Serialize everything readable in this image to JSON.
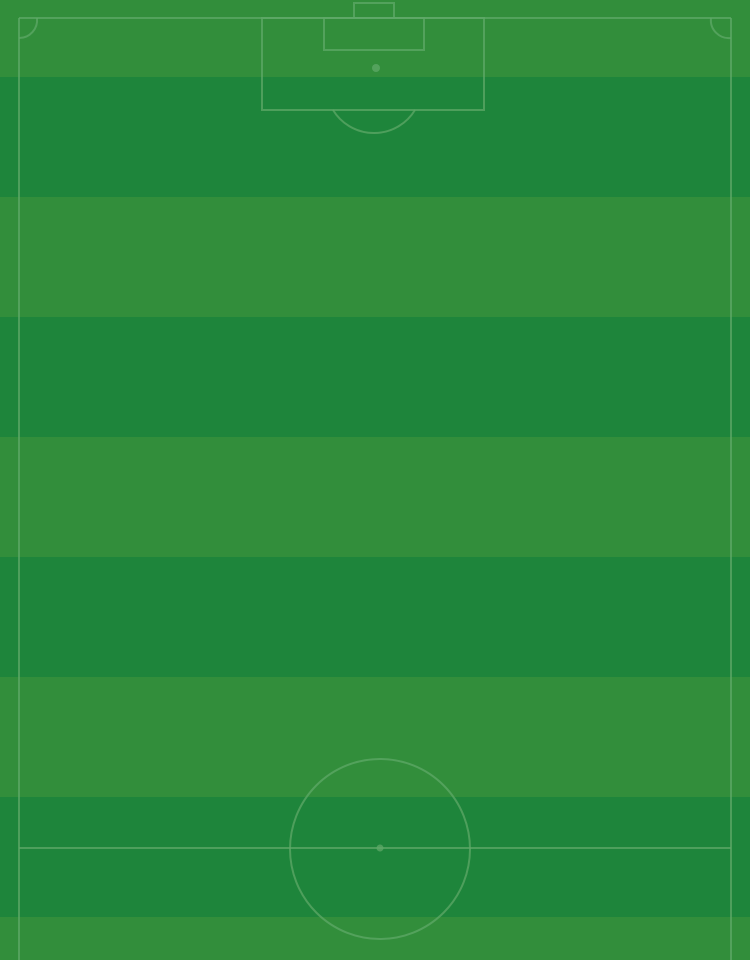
{
  "pitch": {
    "stripe_colors": {
      "light": "#328e3b",
      "dark": "#1e853b"
    },
    "stripe_count": 9,
    "line_color": "#5fa868",
    "line_opacity": 0.75,
    "markings": [
      "touchline-left",
      "touchline-right",
      "goal-line",
      "goal",
      "goal-area",
      "penalty-area",
      "penalty-spot",
      "penalty-arc",
      "corner-arc-left",
      "corner-arc-right",
      "halfway-line",
      "center-circle",
      "center-spot"
    ]
  }
}
